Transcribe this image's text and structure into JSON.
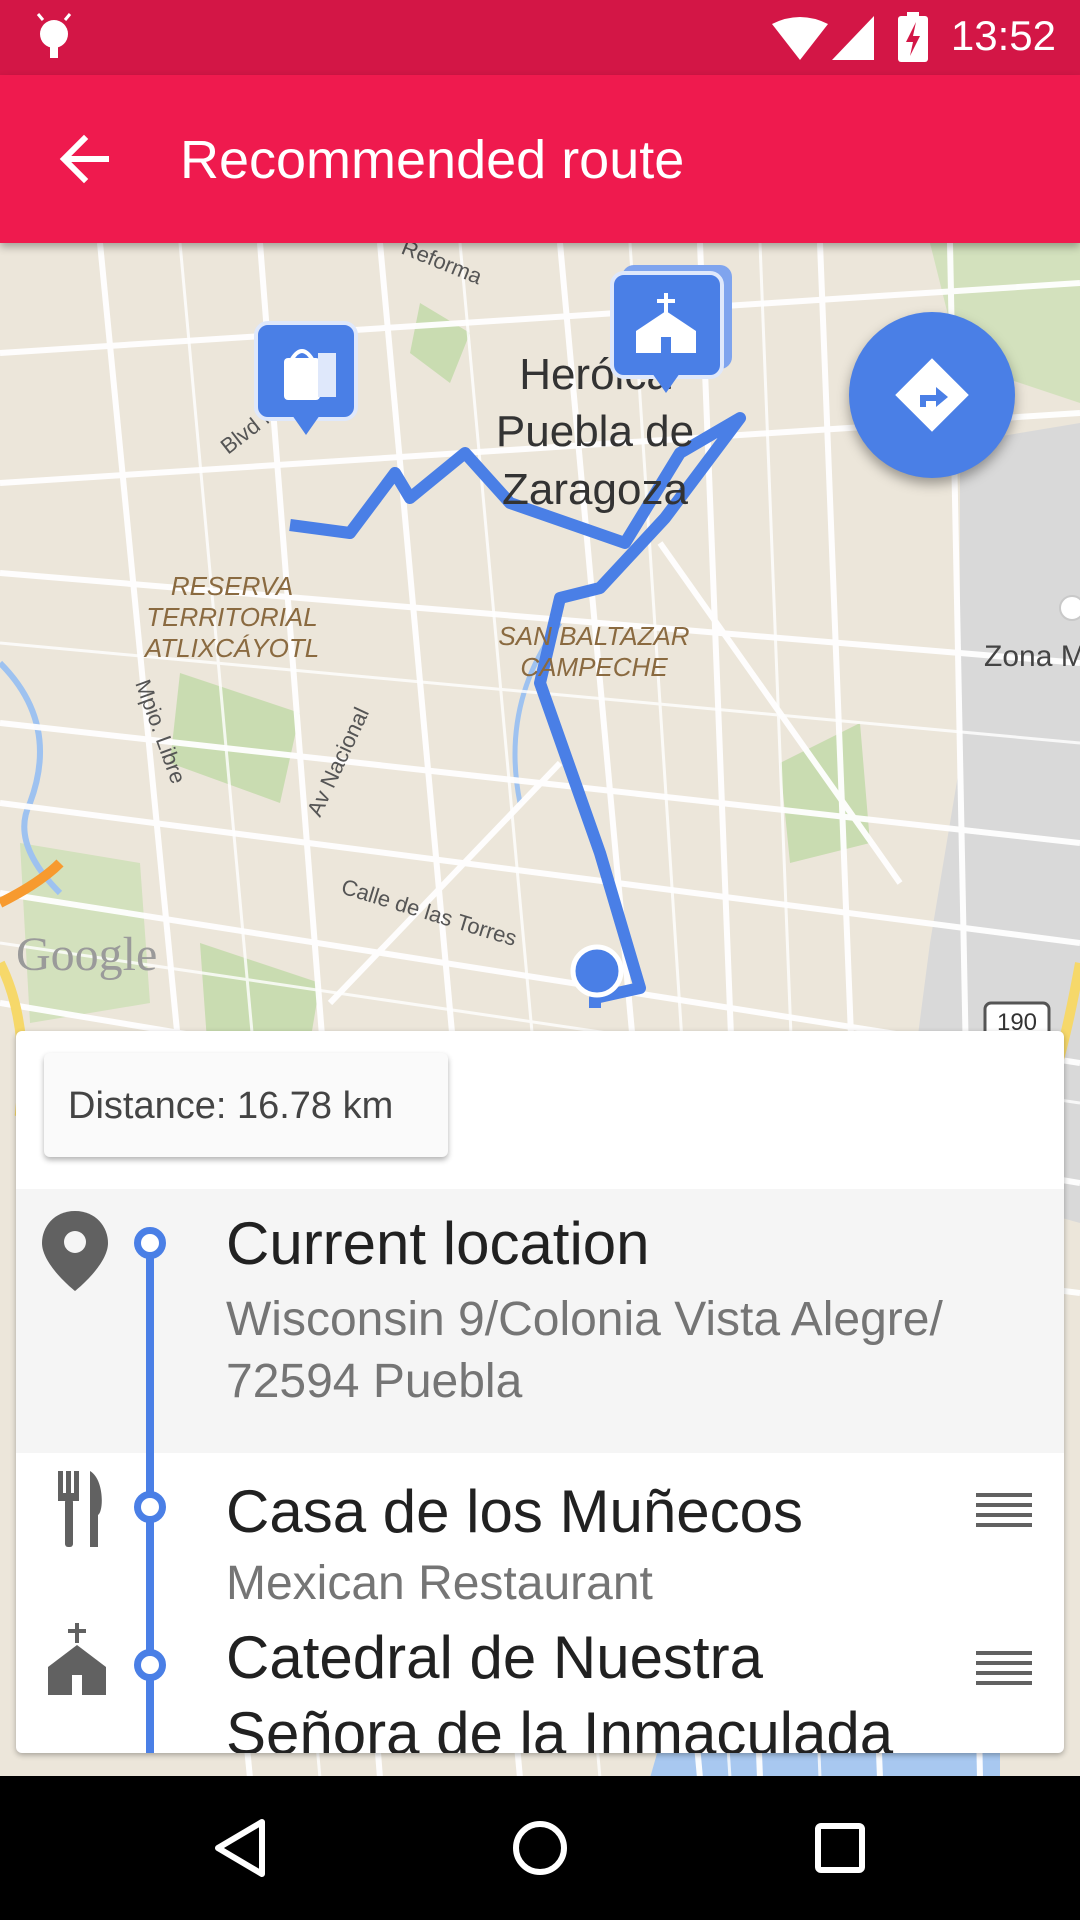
{
  "status_bar": {
    "time": "13:52"
  },
  "app_bar": {
    "title": "Recommended route"
  },
  "map": {
    "labels": {
      "city_line1": "Heróica",
      "city_line2": "Puebla de",
      "city_line3": "Zaragoza",
      "area_reserva_1": "RESERVA",
      "area_reserva_2": "TERRITORIAL",
      "area_reserva_3": "ATLIXCÁYOTL",
      "area_baltazar_1": "SAN BALTAZAR",
      "area_baltazar_2": "CAMPECHE",
      "street_torres": "Calle de las Torres",
      "street_nacional": "Av Nacional",
      "street_mpio": "Mpio. Libre",
      "street_blvd": "Blvd México",
      "street_reforma": "Reforma",
      "zona": "Zona M",
      "highway": "190",
      "brand": "Google"
    }
  },
  "route": {
    "distance": "Distance: 16.78 km",
    "stops": [
      {
        "icon": "location-pin-icon",
        "name": "Current location",
        "sub_line1": "Wisconsin 9/Colonia Vista Alegre/",
        "sub_line2": "72594 Puebla"
      },
      {
        "icon": "restaurant-icon",
        "name": "Casa de los Muñecos",
        "sub_line1": "Mexican Restaurant"
      },
      {
        "icon": "church-icon",
        "name": "Catedral de Nuestra",
        "name_line2": "Señora de la Inmaculada"
      }
    ]
  },
  "colors": {
    "status_bar": "#d31646",
    "app_bar": "#ef1a4e",
    "route_blue": "#4a7fe6"
  }
}
